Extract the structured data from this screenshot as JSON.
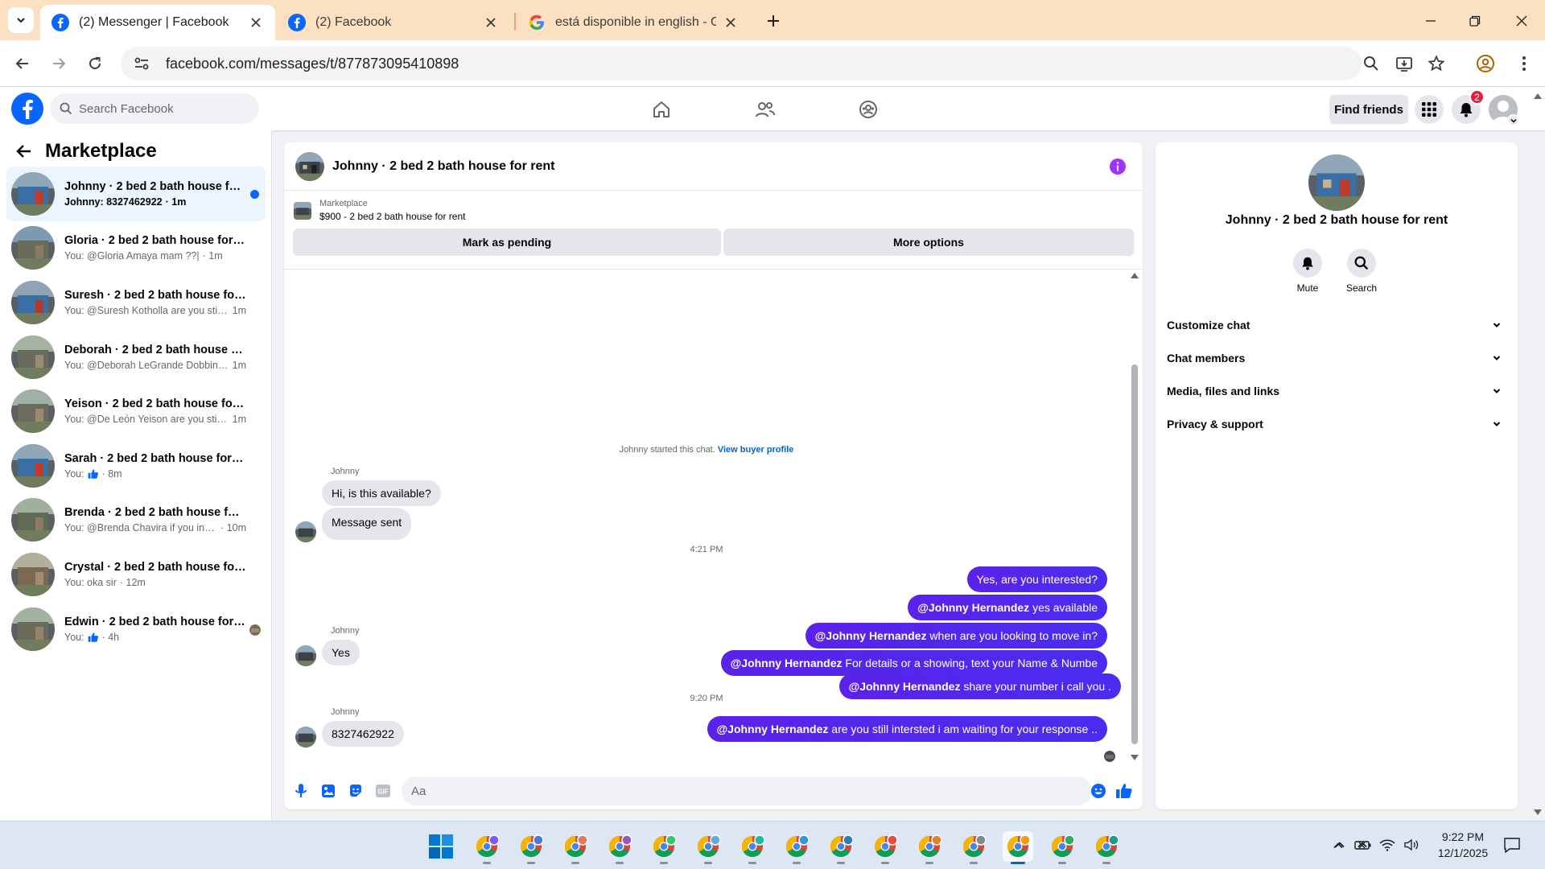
{
  "browser": {
    "tabs": [
      {
        "title": "(2) Messenger | Facebook",
        "active": true
      },
      {
        "title": "(2) Facebook",
        "active": false
      },
      {
        "title": "está disponible in english - Goo",
        "active": false
      }
    ],
    "url": "facebook.com/messages/t/877873095410898"
  },
  "fb_header": {
    "search_placeholder": "Search Facebook",
    "find_friends": "Find friends",
    "notification_count": "2"
  },
  "sidebar": {
    "title": "Marketplace",
    "chats": [
      {
        "name": "Johnny · 2 bed 2 bath house for rent",
        "preview": "Johnny: 8327462922",
        "time": "· 1m",
        "active": true,
        "unread": true
      },
      {
        "name": "Gloria · 2 bed 2 bath house for rent",
        "preview": "You: @Gloria Amaya mam ??|",
        "time": "· 1m"
      },
      {
        "name": "Suresh · 2 bed 2 bath house for rent",
        "preview": "You: @Suresh Kotholla are you still in...",
        "time": "1m"
      },
      {
        "name": "Deborah · 2 bed 2 bath house for rent",
        "preview": "You: @Deborah LeGrande Dobbins ar...",
        "time": "1m"
      },
      {
        "name": "Yeison · 2 bed 2 bath house for rent",
        "preview": "You: @De León Yeison are you still int...",
        "time": "1m"
      },
      {
        "name": "Sarah · 2 bed 2 bath house for rent",
        "preview": "You:",
        "time": "· 8m",
        "thumb_icon": true
      },
      {
        "name": "Brenda · 2 bed 2 bath house for rent",
        "preview": "You: @Brenda Chavira if you interst...",
        "time": "· 10m"
      },
      {
        "name": "Crystal · 2 bed 2 bath house for rent",
        "preview": "You: oka sir",
        "time": "· 12m"
      },
      {
        "name": "Edwin · 2 bed 2 bath house for rent",
        "preview": "You:",
        "time": "· 4h",
        "thumb_icon": true,
        "seen": true
      }
    ]
  },
  "chat": {
    "title": "Johnny · 2 bed 2 bath house for rent",
    "marketplace_label": "Marketplace",
    "listing": "$900 - 2 bed 2 bath house for rent",
    "mark_pending": "Mark as pending",
    "more_options": "More options",
    "system_text": "Johnny started this chat.",
    "view_buyer_profile": "View buyer profile",
    "sender_name": "Johnny",
    "messages_in_1": [
      "Hi, is this available?",
      "Message sent"
    ],
    "time_1": "4:21 PM",
    "out_1": "Yes, are you interested?",
    "mention": "@Johnny Hernandez",
    "out_2": "yes available",
    "out_3": "when are you looking to move in?",
    "out_4": "For details or a showing, text your Name & Numbe",
    "time_2": "9:20 PM",
    "out_5": " are you still intersted i am waiting for your response ..",
    "in_2": "Yes",
    "out_6": "share your number i call you .",
    "in_3": "8327462922",
    "composer_placeholder": "Aa"
  },
  "info_panel": {
    "name": "Johnny · 2 bed 2 bath house for rent",
    "mute": "Mute",
    "search": "Search",
    "sections": [
      "Customize chat",
      "Chat members",
      "Media, files and links",
      "Privacy & support"
    ]
  },
  "taskbar": {
    "time": "9:22 PM",
    "date": "12/1/2025"
  },
  "colors": {
    "fb_blue": "#0866ff",
    "bubble_out": "#5b22ea",
    "info_purple": "#a033ff",
    "tab_bar": "#fce0c2"
  }
}
